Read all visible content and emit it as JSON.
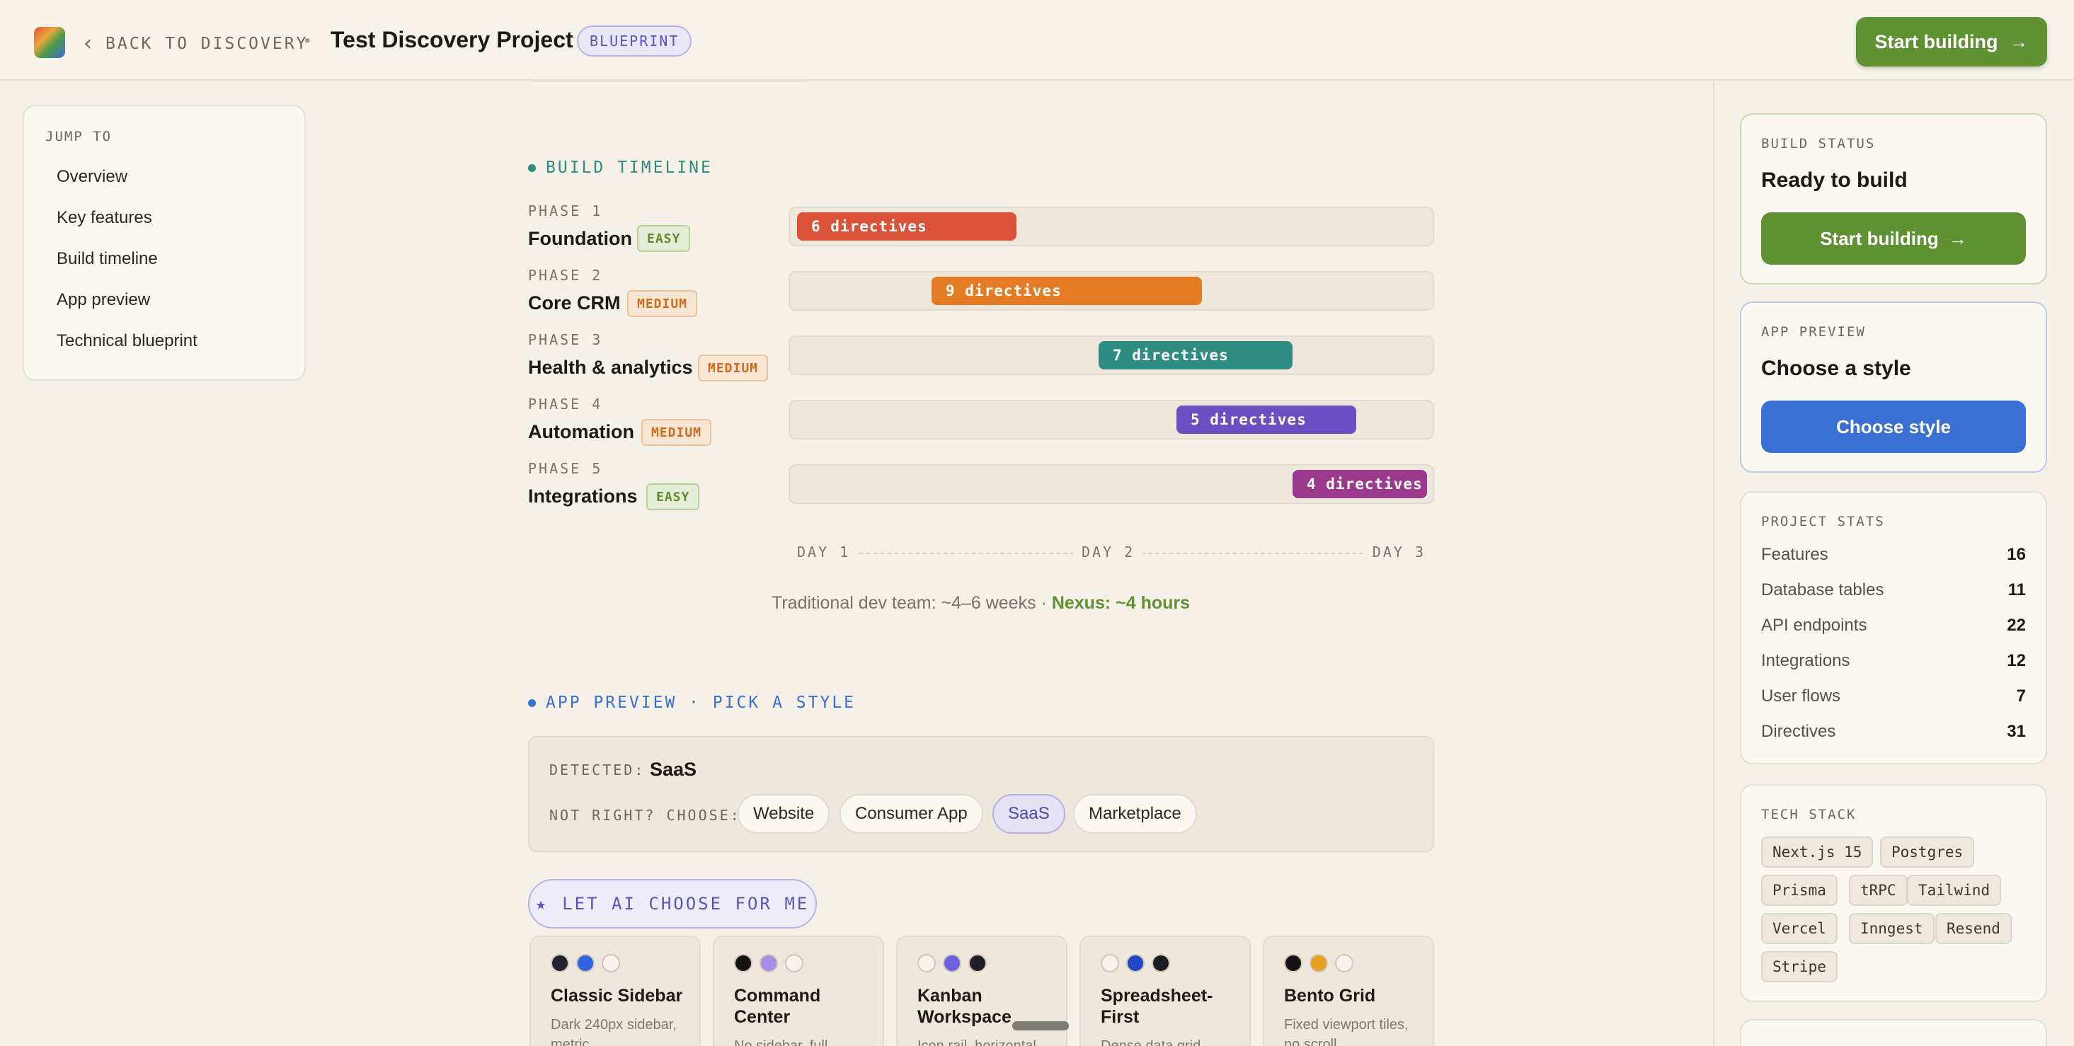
{
  "header": {
    "back_label": "BACK TO DISCOVERY",
    "separator": "•",
    "project_title": "Test Discovery Project",
    "badge": "BLUEPRINT",
    "start_button": "Start building",
    "arrow": "→"
  },
  "jump_to": {
    "title": "JUMP TO",
    "items": [
      "Overview",
      "Key features",
      "Build timeline",
      "App preview",
      "Technical blueprint"
    ]
  },
  "timeline": {
    "heading": "BUILD TIMELINE",
    "phases": [
      {
        "label": "PHASE 1",
        "name": "Foundation",
        "difficulty": "EASY",
        "directives": "6 directives",
        "color": "#dc5238"
      },
      {
        "label": "PHASE 2",
        "name": "Core CRM",
        "difficulty": "MEDIUM",
        "directives": "9 directives",
        "color": "#e27b22"
      },
      {
        "label": "PHASE 3",
        "name": "Health & analytics",
        "difficulty": "MEDIUM",
        "directives": "7 directives",
        "color": "#2f8c82"
      },
      {
        "label": "PHASE 4",
        "name": "Automation",
        "difficulty": "MEDIUM",
        "directives": "5 directives",
        "color": "#6a4fc2"
      },
      {
        "label": "PHASE 5",
        "name": "Integrations",
        "difficulty": "EASY",
        "directives": "4 directives",
        "color": "#9b3a8c"
      }
    ],
    "axis": [
      "DAY 1",
      "DAY 2",
      "DAY 3"
    ],
    "comparison_prefix": "Traditional dev team: ~4–6 weeks · ",
    "comparison_highlight": "Nexus: ~4 hours"
  },
  "app_preview": {
    "heading": "APP PREVIEW · PICK A STYLE",
    "detected_label": "DETECTED:",
    "detected_value": "SaaS",
    "choose_label": "NOT RIGHT? CHOOSE:",
    "options": [
      "Website",
      "Consumer App",
      "SaaS",
      "Marketplace"
    ],
    "selected_option": "SaaS",
    "ai_button": "LET AI CHOOSE FOR ME",
    "ai_icon": "★",
    "styles": [
      {
        "name": "Classic Sidebar",
        "desc": "Dark 240px sidebar, metric",
        "swatches": [
          "#1f2430",
          "#2f63e0",
          "#f6f3ee"
        ]
      },
      {
        "name": "Command Center",
        "desc": "No sidebar, full",
        "swatches": [
          "#141414",
          "#a98ee8",
          "#f6f3ee"
        ]
      },
      {
        "name": "Kanban Workspace",
        "desc": "Icon rail, horizontal",
        "swatches": [
          "#f6f3ee",
          "#6b62e0",
          "#1f2028"
        ]
      },
      {
        "name": "Spreadsheet-First",
        "desc": "Dense data grid",
        "swatches": [
          "#f6f3ee",
          "#2346c8",
          "#1a1c24"
        ]
      },
      {
        "name": "Bento Grid",
        "desc": "Fixed viewport tiles, no scroll",
        "swatches": [
          "#141414",
          "#e8a020",
          "#f6f3ee"
        ]
      }
    ]
  },
  "build_status": {
    "label": "BUILD STATUS",
    "heading": "Ready to build",
    "button": "Start building"
  },
  "preview_card": {
    "label": "APP PREVIEW",
    "heading": "Choose a style",
    "button": "Choose style"
  },
  "stats": {
    "label": "PROJECT STATS",
    "rows": [
      {
        "label": "Features",
        "value": "16"
      },
      {
        "label": "Database tables",
        "value": "11"
      },
      {
        "label": "API endpoints",
        "value": "22"
      },
      {
        "label": "Integrations",
        "value": "12"
      },
      {
        "label": "User flows",
        "value": "7"
      },
      {
        "label": "Directives",
        "value": "31"
      }
    ]
  },
  "tech_stack": {
    "label": "TECH STACK",
    "items": [
      "Next.js 15",
      "Postgres",
      "Prisma",
      "tRPC",
      "Tailwind",
      "Vercel",
      "Inngest",
      "Resend",
      "Stripe"
    ]
  },
  "colors": {
    "accent_green": "#5f9133",
    "accent_blue": "#3a6fd4",
    "timeline_heading": "#2f8c82",
    "preview_heading": "#3a6fd4"
  }
}
